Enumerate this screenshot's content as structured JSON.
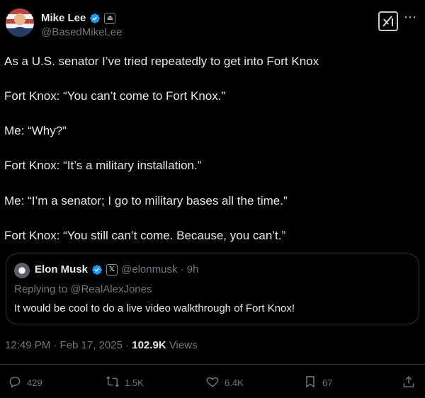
{
  "author": {
    "name": "Mike Lee",
    "handle": "@BasedMikeLee"
  },
  "tweet": {
    "lines": [
      "As a U.S. senator I’ve tried repeatedly to get into Fort Knox",
      "Fort Knox: “You can’t come to Fort Knox.”",
      "Me: “Why?”",
      "Fort Knox: “It’s a military installation.”",
      "Me: “I’m a senator; I go to military bases all the time.”",
      "Fort Knox: “You still can’t come. Because, you can’t.”"
    ]
  },
  "quote": {
    "author_name": "Elon Musk",
    "handle_time": "@elonmusk · 9h",
    "replying_to": "Replying to @RealAlexJones",
    "text": "It would be cool to do a live video walkthrough of Fort Knox!"
  },
  "meta": {
    "timestamp": "12:49 PM · Feb 17, 2025 · ",
    "views_count": "102.9K",
    "views_label": " Views"
  },
  "actions": {
    "replies": "429",
    "reposts": "1.5K",
    "likes": "6.4K",
    "bookmarks": "67"
  },
  "colors": {
    "background": "#000000",
    "text": "#e7e9ea",
    "secondary_text": "#71767b",
    "verified": "#1d9bf0",
    "border": "#2f3336"
  },
  "icons": {
    "grok": "grok-icon",
    "more": "more-icon",
    "reply": "reply-icon",
    "repost": "repost-icon",
    "like": "heart-icon",
    "bookmark": "bookmark-icon",
    "share": "share-icon"
  }
}
